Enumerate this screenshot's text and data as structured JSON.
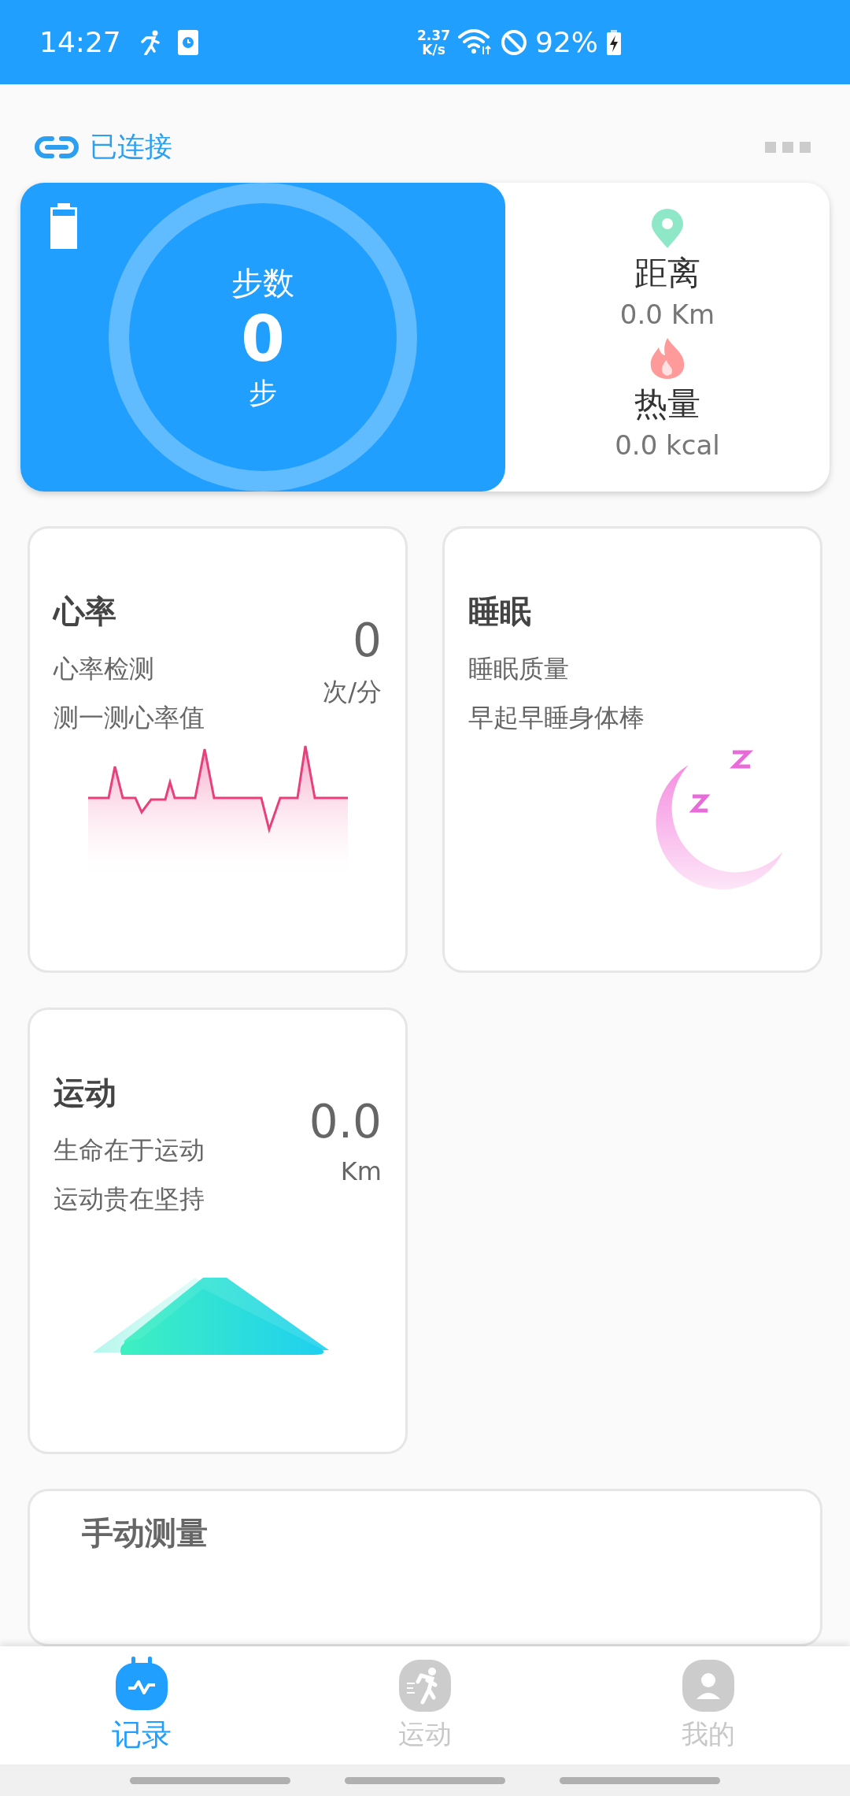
{
  "status_bar": {
    "time": "14:27",
    "speed_value": "2.37",
    "speed_unit": "K/s",
    "battery": "92%"
  },
  "header": {
    "connection": "已连接"
  },
  "steps_card": {
    "label": "步数",
    "value": "0",
    "unit": "步",
    "distance": {
      "label": "距离",
      "value": "0.0 Km"
    },
    "calories": {
      "label": "热量",
      "value": "0.0 kcal"
    }
  },
  "cards": [
    {
      "kind": "heart",
      "title": "心率",
      "lines": [
        "心率检测",
        "测一测心率值"
      ],
      "value": "0",
      "unit": "次/分"
    },
    {
      "kind": "sleep",
      "title": "睡眠",
      "lines": [
        "睡眠质量",
        "早起早睡身体棒"
      ]
    },
    {
      "kind": "sport",
      "title": "运动",
      "lines": [
        "生命在于运动",
        "运动贵在坚持"
      ],
      "value": "0.0",
      "unit": "Km"
    }
  ],
  "manual_card": {
    "title": "手动测量"
  },
  "tabs": [
    {
      "kind": "record",
      "label": "记录",
      "selected": true
    },
    {
      "kind": "sport",
      "label": "运动",
      "selected": false
    },
    {
      "kind": "me",
      "label": "我的",
      "selected": false
    }
  ]
}
